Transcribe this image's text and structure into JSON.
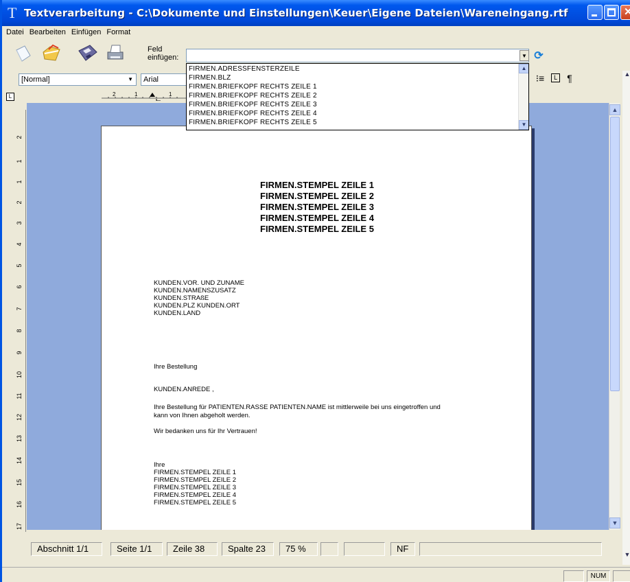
{
  "window": {
    "title": "Textverarbeitung - C:\\Dokumente und Einstellungen\\Keuer\\Eigene Dateien\\Wareneingang.rtf",
    "app_icon": "T"
  },
  "menu": [
    "Datei",
    "Bearbeiten",
    "Einfügen",
    "Format"
  ],
  "toolbar": {
    "feld_label_line1": "Feld",
    "feld_label_line2": "einfügen:",
    "feld_value": ""
  },
  "field_dropdown": [
    "FIRMEN.ADRESSFENSTERZEILE",
    "FIRMEN.BLZ",
    "FIRMEN.BRIEFKOPF RECHTS ZEILE 1",
    "FIRMEN.BRIEFKOPF RECHTS ZEILE 2",
    "FIRMEN.BRIEFKOPF RECHTS ZEILE 3",
    "FIRMEN.BRIEFKOPF RECHTS ZEILE 4",
    "FIRMEN.BRIEFKOPF RECHTS ZEILE 5"
  ],
  "format": {
    "style": "[Normal]",
    "font": "Arial"
  },
  "ruler": {
    "vertical_labels": [
      "2",
      "1",
      "1",
      "2",
      "3",
      "4",
      "5",
      "6",
      "7",
      "8",
      "9",
      "10",
      "11",
      "12",
      "13",
      "14",
      "15",
      "16",
      "17",
      "18"
    ]
  },
  "document": {
    "stempel": [
      "FIRMEN.STEMPEL ZEILE 1",
      "FIRMEN.STEMPEL ZEILE 2",
      "FIRMEN.STEMPEL ZEILE 3",
      "FIRMEN.STEMPEL ZEILE 4",
      "FIRMEN.STEMPEL ZEILE 5"
    ],
    "address": [
      "KUNDEN.VOR. UND ZUNAME",
      "KUNDEN.NAMENSZUSATZ",
      "KUNDEN.STRAßE",
      "KUNDEN.PLZ KUNDEN.ORT",
      "KUNDEN.LAND"
    ],
    "subject": "Ihre Bestellung",
    "salutation": "KUNDEN.ANREDE ,",
    "para1_line1": "Ihre Bestellung für PATIENTEN.RASSE PATIENTEN.NAME ist mittlerweile bei uns eingetroffen und",
    "para1_line2": "kann von Ihnen abgeholt werden.",
    "para2": "Wir bedanken uns für Ihr Vertrauen!",
    "closing": "Ihre",
    "signature": [
      "FIRMEN.STEMPEL ZEILE 1",
      "FIRMEN.STEMPEL ZEILE 2",
      "FIRMEN.STEMPEL ZEILE 3",
      "FIRMEN.STEMPEL ZEILE 4",
      "FIRMEN.STEMPEL ZEILE 5"
    ]
  },
  "status": {
    "abschnitt": "Abschnitt 1/1",
    "seite": "Seite 1/1",
    "zeile": "Zeile 38",
    "spalte": "Spalte 23",
    "zoom": "75 %",
    "nf": "NF",
    "num": "NUM"
  }
}
